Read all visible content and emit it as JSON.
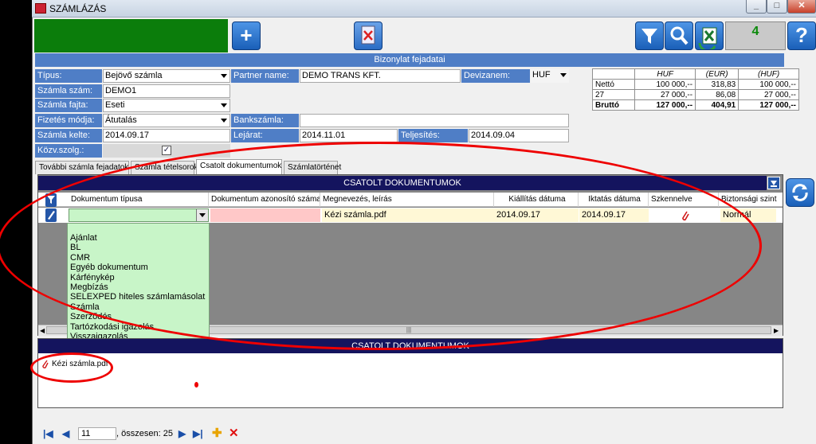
{
  "window": {
    "title": "SZÁMLÁZÁS",
    "min_label": "_",
    "max_label": "□",
    "close_label": "✕"
  },
  "toolbar": {
    "add_icon": "plus-icon",
    "delete_icon": "delete-doc-icon",
    "filter_icon": "filter-icon",
    "search_icon": "search-icon",
    "excel_icon": "excel-icon",
    "help_label": "?",
    "counter": "4",
    "accent_green": "#0b7d0b"
  },
  "header": {
    "title": "Bizonylat fejadatai"
  },
  "form": {
    "tipus_label": "Típus:",
    "tipus_value": "Bejövő számla",
    "szamlaszam_label": "Számla szám:",
    "szamlaszam_value": "DEMO1",
    "fajta_label": "Számla fajta:",
    "fajta_value": "Eseti",
    "fizetes_label": "Fizetés módja:",
    "fizetes_value": "Átutalás",
    "kelte_label": "Számla kelte:",
    "kelte_value": "2014.09.17",
    "kozv_label": "Közv.szolg.:",
    "kozv_checked": "✓",
    "partner_label": "Partner name:",
    "partner_value": "DEMO TRANS KFT.",
    "deviza_label": "Devizanem:",
    "deviza_value": "HUF",
    "bank_label": "Bankszámla:",
    "bank_value": "",
    "lejarat_label": "Lejárat:",
    "lejarat_value": "2014.11.01",
    "teljesites_label": "Teljesítés:",
    "teljesites_value": "2014.09.04"
  },
  "summary": {
    "headers": [
      "",
      "HUF",
      "(EUR)",
      "(HUF)"
    ],
    "rows": [
      [
        "Nettó",
        "100 000,--",
        "318,83",
        "100 000,--"
      ],
      [
        "27",
        "27 000,--",
        "86,08",
        "27 000,--"
      ],
      [
        "Bruttó",
        "127 000,--",
        "404,91",
        "127 000,--"
      ]
    ]
  },
  "tabs": [
    "További számla fejadatok",
    "Számla tételsorok",
    "Csatolt dokumentumok",
    "Számlatörténet"
  ],
  "docs": {
    "title": "CSATOLT DOKUMENTUMOK",
    "columns": [
      "Dokumentum típusa",
      "Dokumentum azonosító száma",
      "Megnevezés, leírás",
      "Kiállítás dátuma",
      "Iktatás dátuma",
      "Szkennelve",
      "Biztonsági szint"
    ],
    "row": {
      "tipus": "",
      "azonosito": "",
      "megnevezes": "Kézi számla.pdf",
      "kiallitas": "2014.09.17",
      "iktatas": "2014.09.17",
      "szkennelve_icon": "paperclip-icon",
      "biztonsagi": "Normál"
    },
    "dropdown_options": [
      "Ajánlat",
      "BL",
      "CMR",
      "Egyéb dokumentum",
      "Kárfénykép",
      "Megbízás",
      "SELEXPED hiteles számlamásolat",
      "Számla",
      "Szerződés",
      "Tartózkodási igazolás",
      "Visszaigazolás"
    ],
    "scroll_grip": "|||"
  },
  "attachments": {
    "title": "CSATOLT DOKUMENTUMOK",
    "files": [
      "Kézi számla.pdf"
    ]
  },
  "navigator": {
    "current": "11",
    "total_text": ", összesen: 25"
  },
  "annotation_color": "#e00000"
}
